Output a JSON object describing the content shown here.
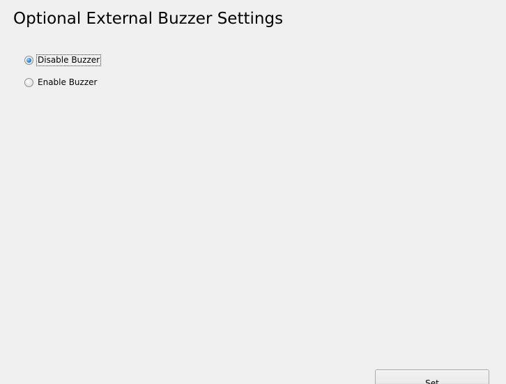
{
  "header": {
    "title": "Optional External Buzzer Settings"
  },
  "buzzer_options": {
    "items": [
      {
        "label": "Disable Buzzer",
        "selected": true
      },
      {
        "label": "Enable Buzzer",
        "selected": false
      }
    ]
  },
  "actions": {
    "set_label": "Set"
  },
  "colors": {
    "background": "#f0f0f0",
    "radio_selected": "#3f8fd8"
  }
}
